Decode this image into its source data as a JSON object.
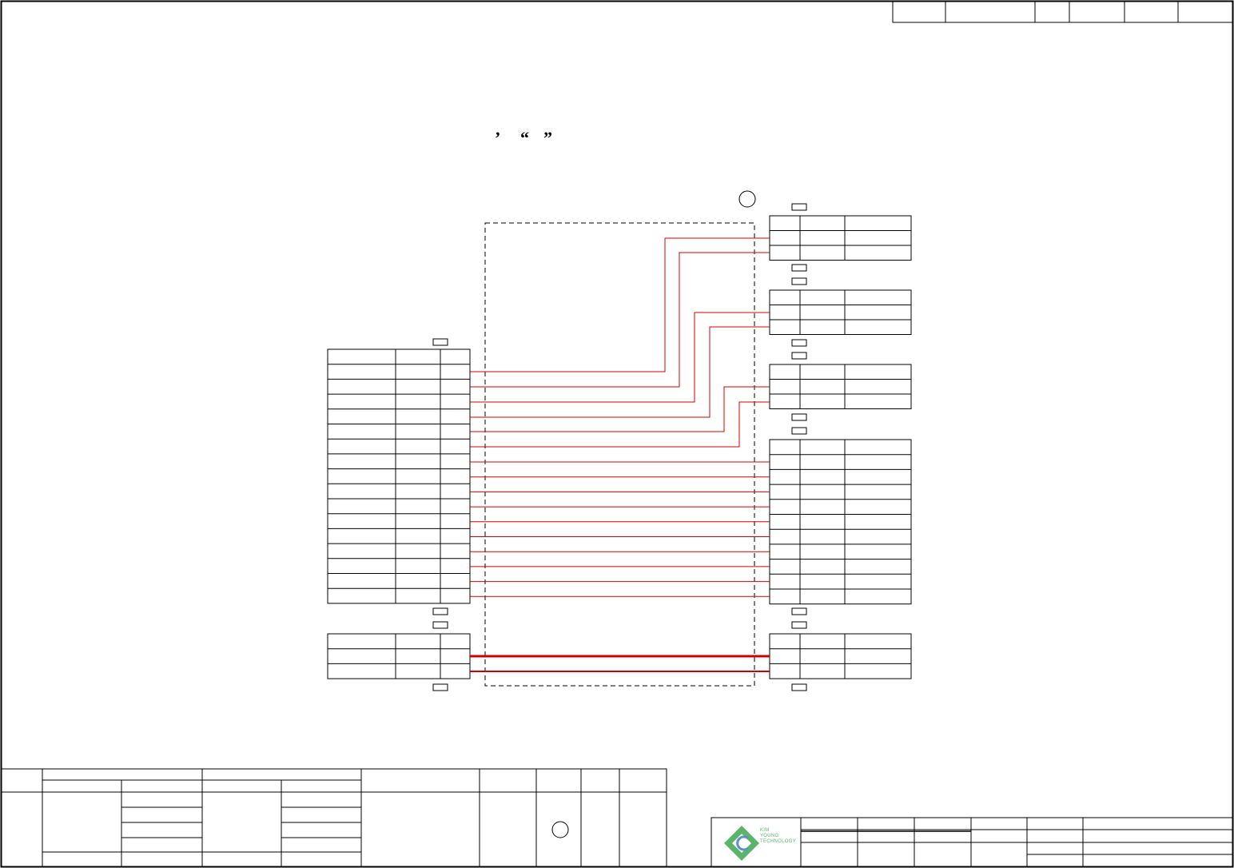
{
  "drawing": {
    "quote_marks": [
      "’",
      "“",
      "”"
    ],
    "logo": {
      "lines": [
        "KIM",
        "YOUNG",
        "TECHNOLOGY"
      ],
      "color": "#5ab56b"
    },
    "wire_color": "#d40000"
  }
}
